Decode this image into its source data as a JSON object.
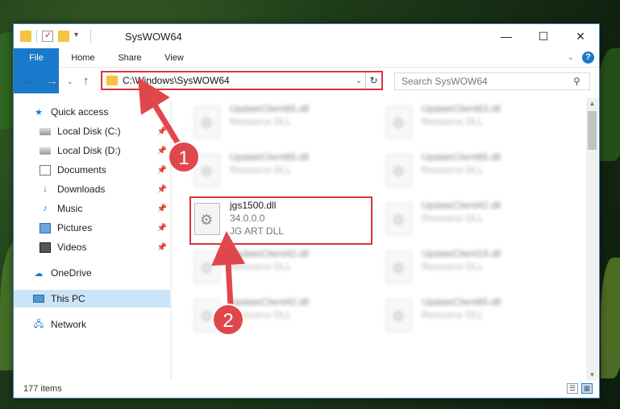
{
  "window": {
    "title": "SysWOW64",
    "controls": {
      "minimize": "—",
      "maximize": "☐",
      "close": "✕"
    }
  },
  "ribbon": {
    "tabs": [
      "File",
      "Home",
      "Share",
      "View"
    ],
    "help": "?"
  },
  "address": {
    "path": "C:\\Windows\\SysWOW64"
  },
  "search": {
    "placeholder": "Search SysWOW64"
  },
  "sidebar": {
    "items": [
      {
        "label": "Quick access",
        "icon": "star-icon"
      },
      {
        "label": "Local Disk (C:)",
        "icon": "disk-icon",
        "pinned": true
      },
      {
        "label": "Local Disk (D:)",
        "icon": "disk-icon",
        "pinned": true
      },
      {
        "label": "Documents",
        "icon": "document-icon",
        "pinned": true
      },
      {
        "label": "Downloads",
        "icon": "download-icon",
        "pinned": true
      },
      {
        "label": "Music",
        "icon": "music-icon",
        "pinned": true
      },
      {
        "label": "Pictures",
        "icon": "pictures-icon",
        "pinned": true
      },
      {
        "label": "Videos",
        "icon": "videos-icon",
        "pinned": true
      },
      {
        "label": "OneDrive",
        "icon": "cloud-icon"
      },
      {
        "label": "This PC",
        "icon": "computer-icon",
        "selected": true
      },
      {
        "label": "Network",
        "icon": "network-icon"
      }
    ]
  },
  "files": {
    "left": [
      {
        "name": "UpdateClient65.dll",
        "type": "Resource DLL"
      },
      {
        "name": "UpdateClient65.dll",
        "type": "Resource DLL"
      },
      {
        "name": "jgs1500.dll",
        "version": "34.0.0.0",
        "type": "JG ART DLL"
      },
      {
        "name": "UpdateClient42.dll",
        "type": "Resource DLL"
      },
      {
        "name": "UpdateClient42.dll",
        "type": "Resource DLL"
      }
    ],
    "right": [
      {
        "name": "UpdateClient63.dll",
        "type": "Resource DLL"
      },
      {
        "name": "UpdateClient65.dll",
        "type": "Resource DLL"
      },
      {
        "name": "UpdateClient42.dll",
        "type": "Resource DLL"
      },
      {
        "name": "UpdateClient19.dll",
        "type": "Resource DLL"
      },
      {
        "name": "UpdateClient65.dll",
        "type": "Resource DLL"
      }
    ]
  },
  "status": {
    "item_count": "177 items"
  },
  "callouts": [
    "1",
    "2"
  ],
  "colors": {
    "accent": "#1979ca",
    "highlight": "#d9343a",
    "callout": "#e0474c"
  }
}
